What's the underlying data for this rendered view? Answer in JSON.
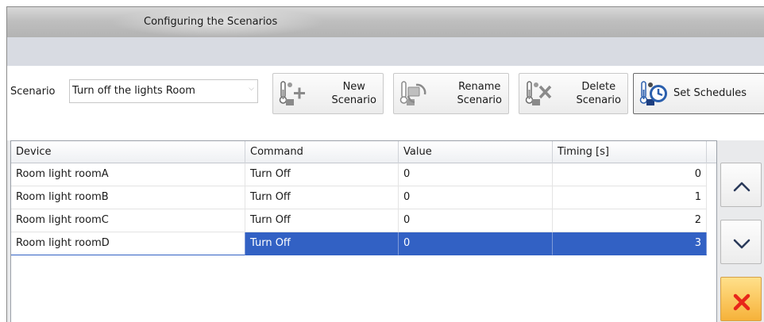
{
  "window": {
    "title": "Configuring the Scenarios"
  },
  "toolbar": {
    "scenario_label": "Scenario",
    "scenario_value": "Turn off the lights Room",
    "buttons": {
      "new": [
        "New",
        "Scenario"
      ],
      "rename": [
        "Rename",
        "Scenario"
      ],
      "delete": [
        "Delete",
        "Scenario"
      ],
      "schedules": "Set Schedules"
    }
  },
  "grid": {
    "columns": [
      "Device",
      "Command",
      "Value",
      "Timing [s]"
    ],
    "rows": [
      [
        "Room light roomA",
        "Turn Off",
        "0",
        "0"
      ],
      [
        "Room light roomB",
        "Turn Off",
        "0",
        "1"
      ],
      [
        "Room light roomC",
        "Turn Off",
        "0",
        "2"
      ],
      [
        "Room light roomD",
        "Turn Off",
        "0",
        "3"
      ]
    ],
    "selected_row": 3
  },
  "icons": {
    "new": "sensor-plus-icon",
    "rename": "sensor-rename-icon",
    "delete": "sensor-x-icon",
    "schedules": "sensor-clock-icon",
    "up": "chevron-up-icon",
    "down": "chevron-down-icon",
    "remove": "red-x-icon"
  },
  "colors": {
    "selection": "#3261c4",
    "remove": "#e8261a",
    "accent_blue": "#2b5fad"
  }
}
